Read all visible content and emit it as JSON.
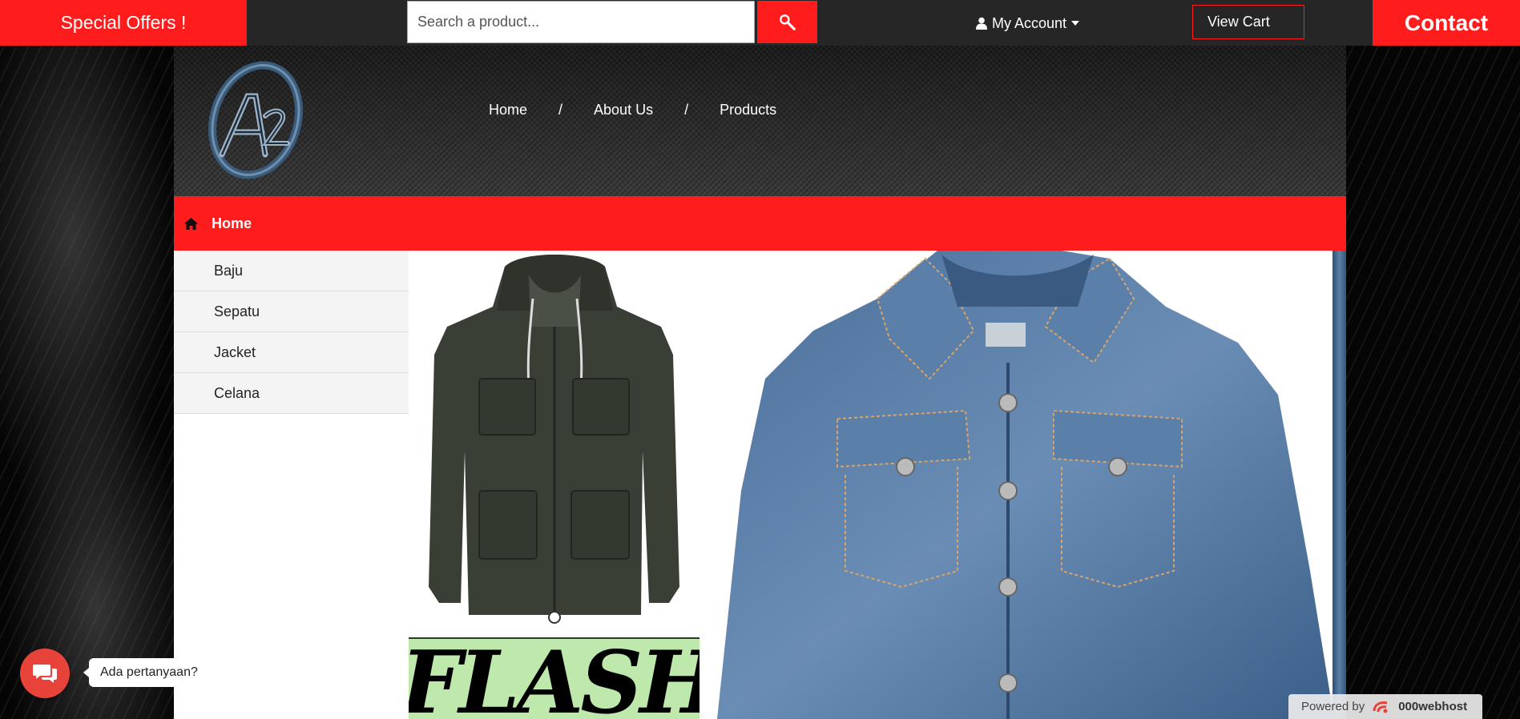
{
  "topbar": {
    "offers_label": "Special Offers !",
    "search_placeholder": "Search a product...",
    "account_label": "My Account",
    "view_cart_label": "View Cart",
    "contact_label": "Contact"
  },
  "header": {
    "logo_text": "AZ",
    "nav": [
      {
        "label": "Home"
      },
      {
        "label": "About Us"
      },
      {
        "label": "Products"
      }
    ],
    "separator": "/"
  },
  "homebar": {
    "label": "Home"
  },
  "sidebar": {
    "categories": [
      {
        "label": "Baju"
      },
      {
        "label": "Sepatu"
      },
      {
        "label": "Jacket"
      },
      {
        "label": "Celana"
      }
    ]
  },
  "main": {
    "banner_text": "FLASH"
  },
  "chat": {
    "prompt": "Ada pertanyaan?"
  },
  "footer_badge": {
    "prefix": "Powered by",
    "brand": "000webhost"
  },
  "colors": {
    "accent": "#ff1c1c",
    "topbar": "#262626",
    "chat": "#e8433a"
  }
}
